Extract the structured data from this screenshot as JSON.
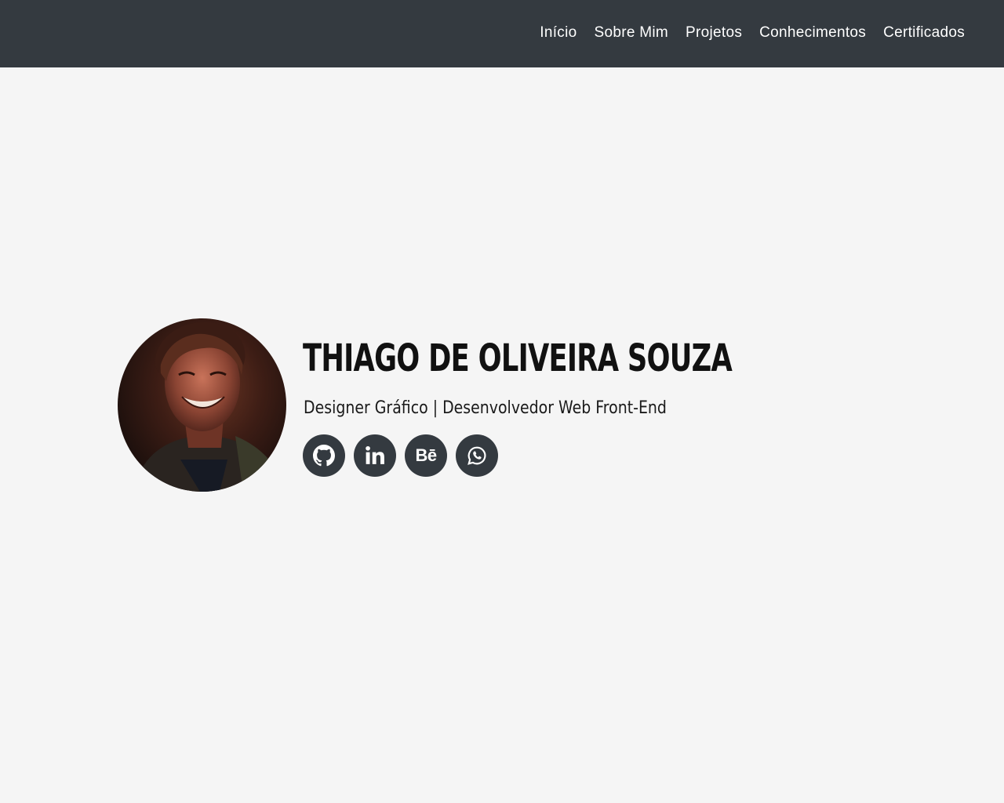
{
  "nav": {
    "items": [
      {
        "label": "Início"
      },
      {
        "label": "Sobre Mim"
      },
      {
        "label": "Projetos"
      },
      {
        "label": "Conhecimentos"
      },
      {
        "label": "Certificados"
      }
    ]
  },
  "hero": {
    "name": "THIAGO DE OLIVEIRA SOUZA",
    "subtitle": "Designer Gráfico | Desenvolvedor Web Front-End",
    "socials": [
      {
        "icon": "github-icon"
      },
      {
        "icon": "linkedin-icon"
      },
      {
        "icon": "behance-icon",
        "text": "Bē"
      },
      {
        "icon": "whatsapp-icon"
      }
    ]
  },
  "colors": {
    "navbar": "#343a40",
    "background": "#f5f5f5",
    "social_bg": "#343a40",
    "text": "#111111"
  }
}
